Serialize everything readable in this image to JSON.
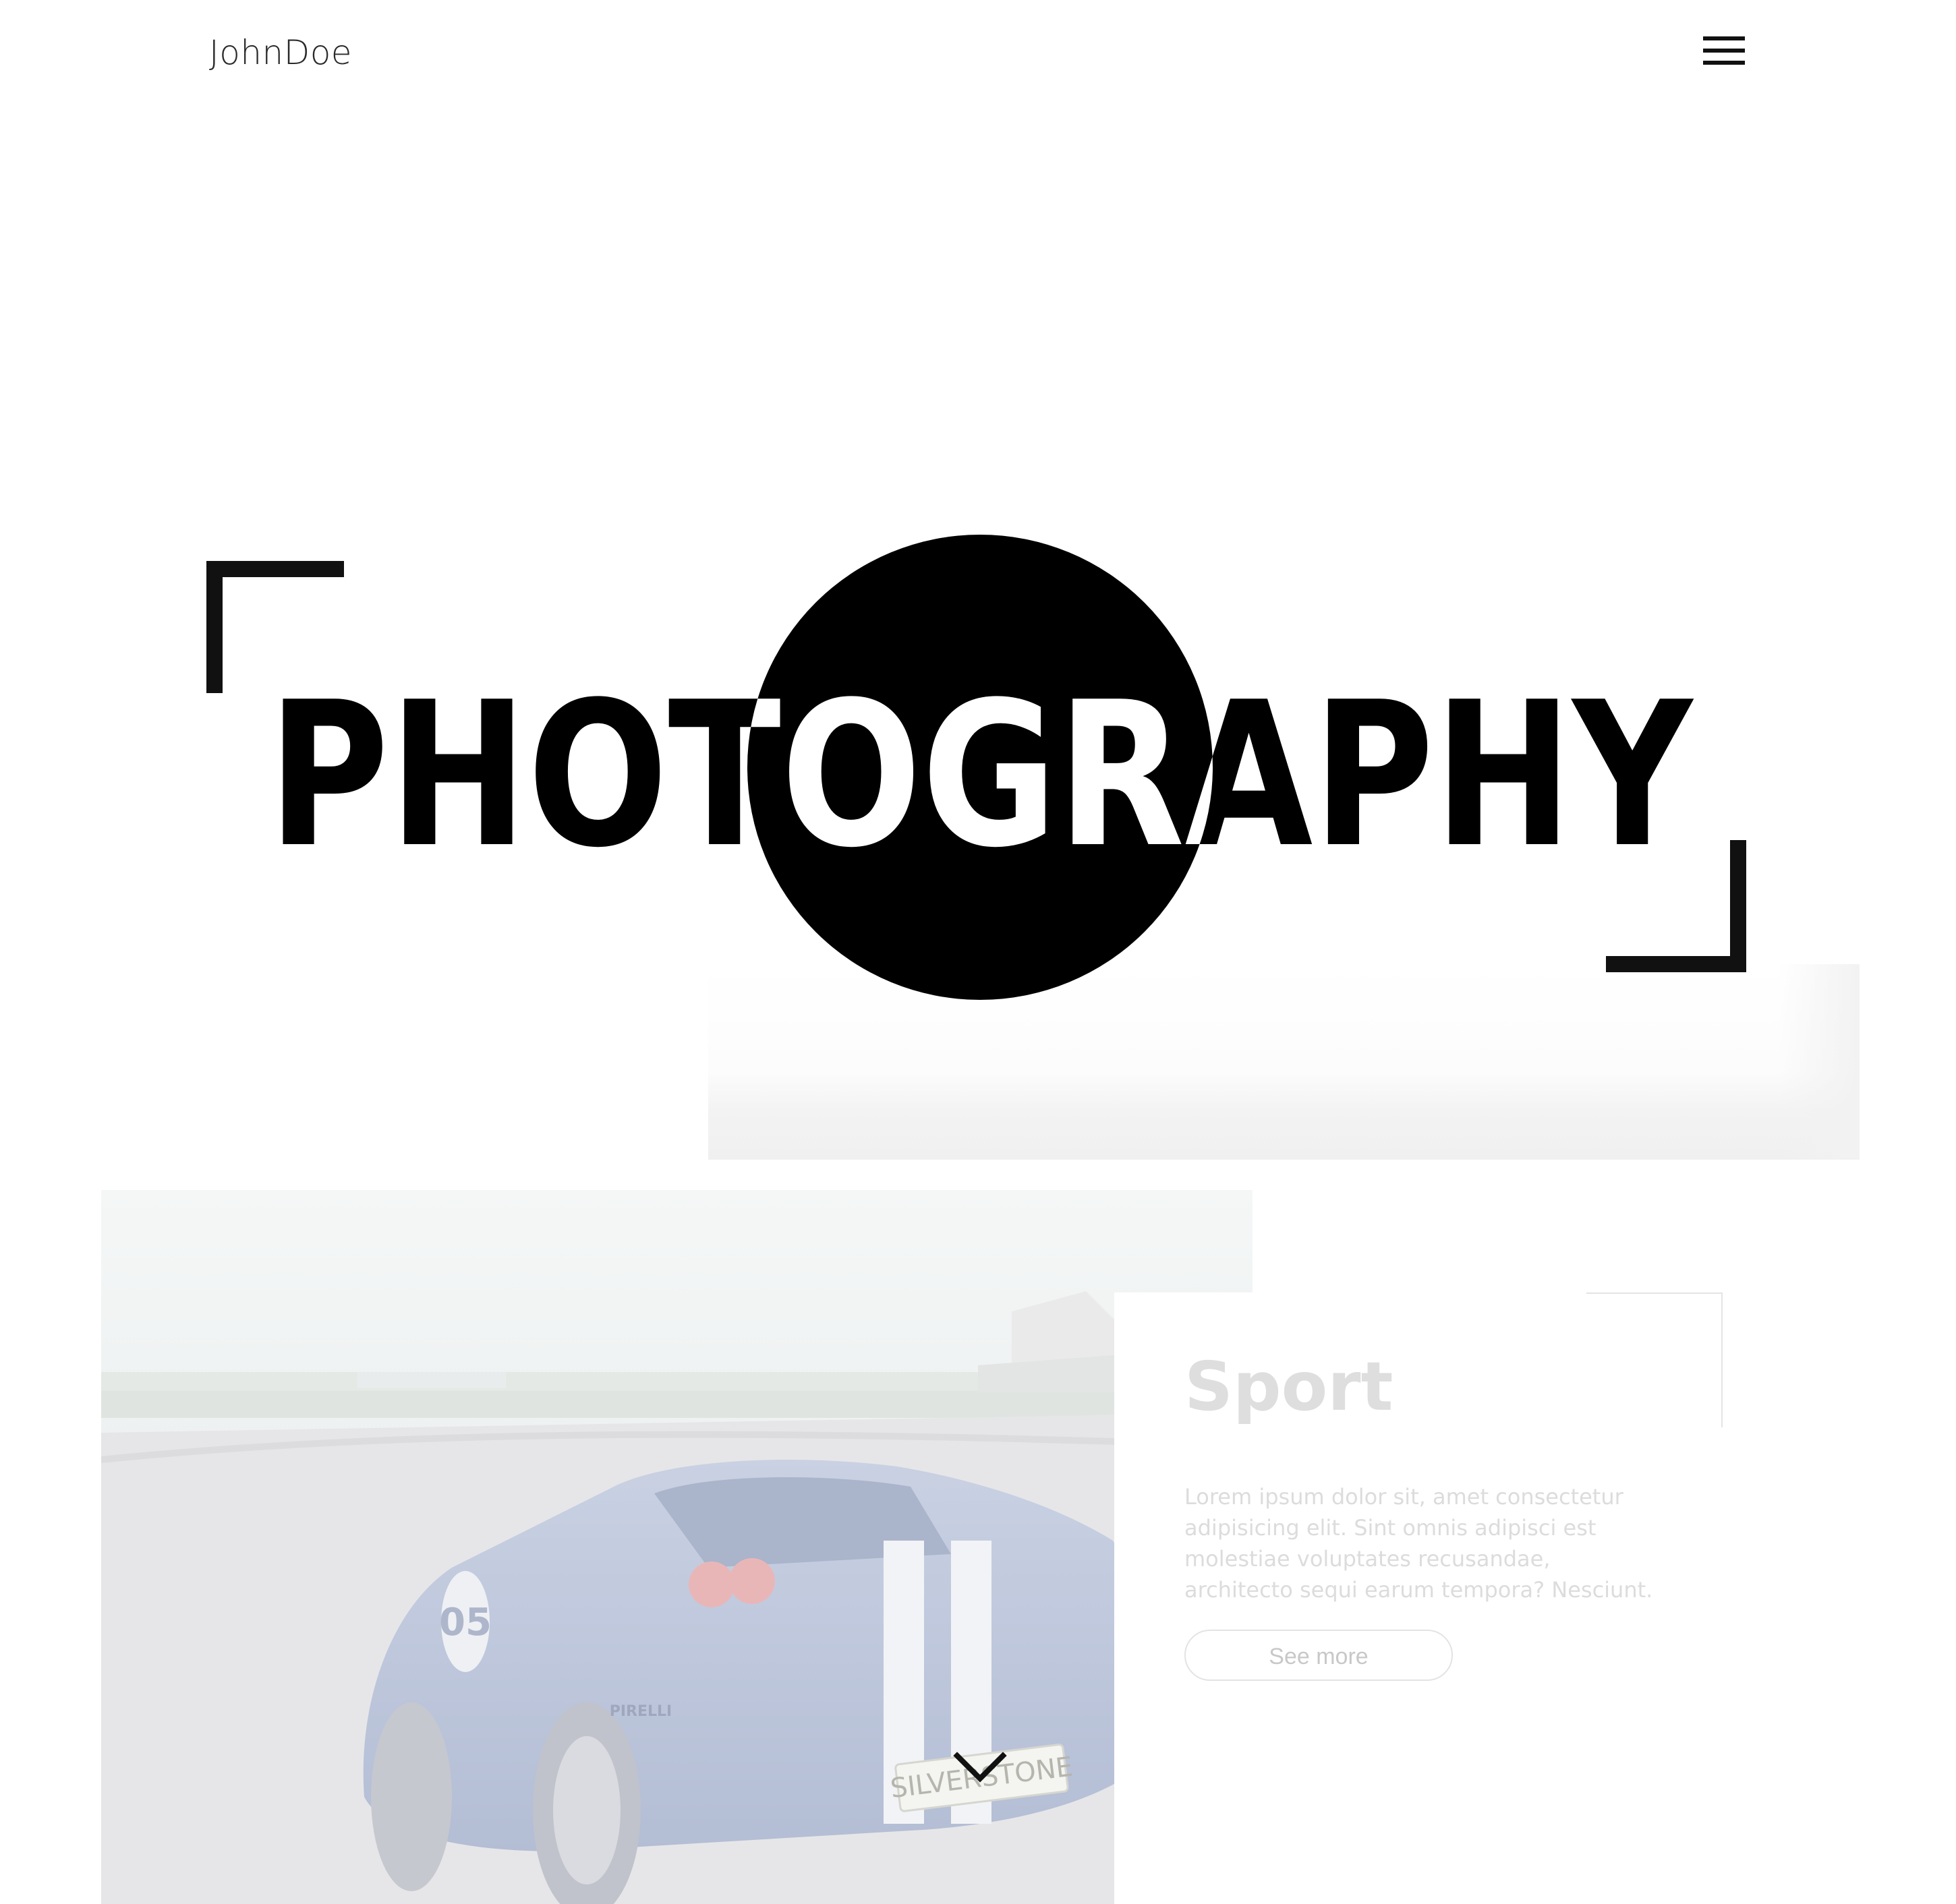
{
  "header": {
    "brand": "JohnDoe",
    "menu_icon": "hamburger-menu-icon"
  },
  "hero": {
    "title": "PHOTOGRAPHY",
    "decoration_icons": [
      "corner-bracket-top-left-icon",
      "corner-bracket-bottom-right-icon",
      "lens-circle-icon"
    ]
  },
  "featured": {
    "category_title": "Sport",
    "description": "Lorem ipsum dolor sit, amet consectetur adipisicing elit. Sint omnis adipisci est molestiae voluptates recusandae, architecto sequi earum tempora? Nesciunt.",
    "button_label": "See more",
    "photo_text": [
      "SILVERSTONE",
      "05",
      "PIRELLI"
    ]
  },
  "scroll": {
    "icon": "chevron-down-icon"
  },
  "colors": {
    "text_dark": "#111111",
    "muted_text": "#dcdcdc",
    "background": "#ffffff"
  }
}
